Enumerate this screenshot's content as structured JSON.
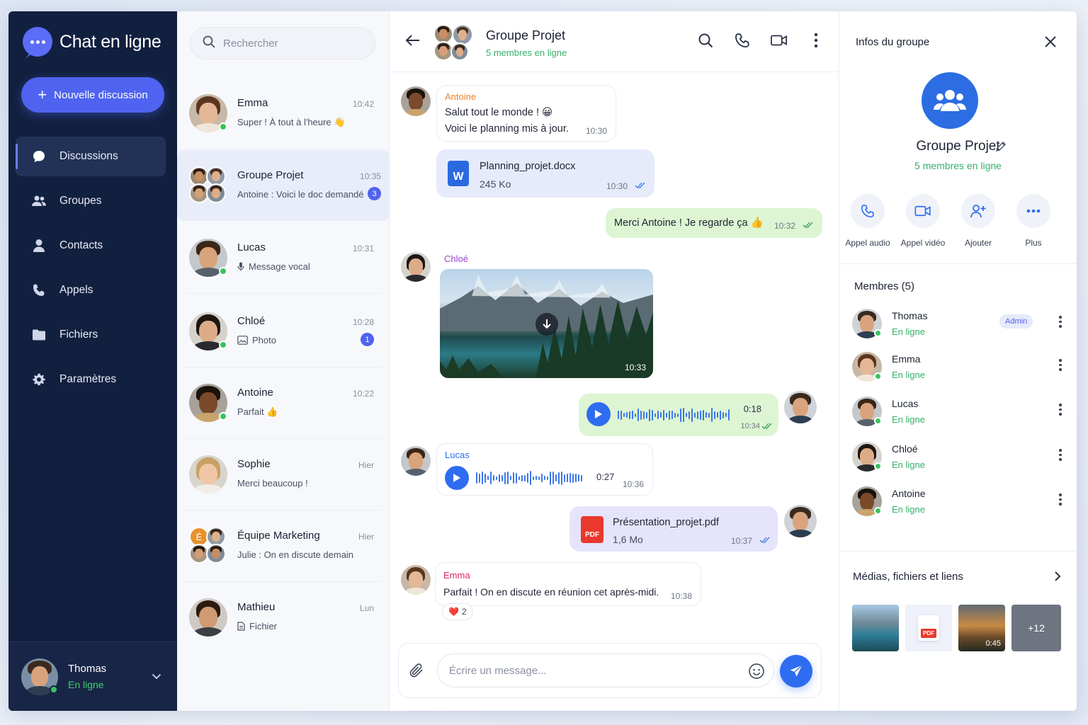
{
  "app": {
    "title": "Chat en ligne",
    "new_chat_label": "Nouvelle discussion"
  },
  "nav": {
    "items": [
      {
        "label": "Discussions",
        "icon": "chat-bubble-icon",
        "active": true
      },
      {
        "label": "Groupes",
        "icon": "users-icon"
      },
      {
        "label": "Contacts",
        "icon": "person-icon"
      },
      {
        "label": "Appels",
        "icon": "phone-icon"
      },
      {
        "label": "Fichiers",
        "icon": "folder-icon"
      },
      {
        "label": "Paramètres",
        "icon": "gear-icon"
      }
    ]
  },
  "current_user": {
    "name": "Thomas",
    "status": "En ligne"
  },
  "search": {
    "placeholder": "Rechercher"
  },
  "conversations": [
    {
      "name": "Emma",
      "time": "10:42",
      "preview": "Super ! À tout à l'heure 👋",
      "online": true
    },
    {
      "name": "Groupe Projet",
      "time": "10:35",
      "preview": "Antoine : Voici le doc demandé",
      "badge": "3",
      "active": true
    },
    {
      "name": "Lucas",
      "time": "10:31",
      "preview": "Message vocal",
      "preview_icon": "microphone-icon",
      "online": true
    },
    {
      "name": "Chloé",
      "time": "10:28",
      "preview": "Photo",
      "preview_icon": "image-icon",
      "badge": "1",
      "online": true
    },
    {
      "name": "Antoine",
      "time": "10:22",
      "preview": "Parfait 👍",
      "online": true
    },
    {
      "name": "Sophie",
      "time": "Hier",
      "preview": "Merci beaucoup !"
    },
    {
      "name": "Équipe Marketing",
      "time": "Hier",
      "preview": "Julie : On en discute demain",
      "group_letter": "É"
    },
    {
      "name": "Mathieu",
      "time": "Lun",
      "preview": "Fichier",
      "preview_icon": "file-icon"
    }
  ],
  "chat": {
    "title": "Groupe Projet",
    "subtitle": "5 membres en ligne",
    "messages": {
      "m1": {
        "sender": "Antoine",
        "line1": "Salut tout le monde ! 😀",
        "line2": "Voici le planning mis à jour.",
        "time": "10:30"
      },
      "m2": {
        "file_name": "Planning_projet.docx",
        "file_size": "245 Ko",
        "file_letter": "W",
        "time": "10:30"
      },
      "m3": {
        "text": "Merci Antoine ! Je regarde ça 👍",
        "time": "10:32"
      },
      "m4": {
        "sender": "Chloé",
        "time": "10:33"
      },
      "m5": {
        "duration": "0:18",
        "time": "10:34"
      },
      "m6": {
        "sender": "Lucas",
        "duration": "0:27",
        "time": "10:36"
      },
      "m7": {
        "file_name": "Présentation_projet.pdf",
        "file_size": "1,6 Mo",
        "file_badge": "PDF",
        "time": "10:37"
      },
      "m8": {
        "sender": "Emma",
        "text": "Parfait ! On en discute en réunion cet après-midi.",
        "time": "10:38",
        "reaction": "❤️",
        "reaction_count": "2"
      }
    },
    "composer_placeholder": "Écrire un message..."
  },
  "info": {
    "title": "Infos du groupe",
    "group_name": "Groupe Projet",
    "group_status": "5 membres en ligne",
    "actions": [
      "Appel audio",
      "Appel vidéo",
      "Ajouter",
      "Plus"
    ],
    "members_title": "Membres (5)",
    "members": [
      {
        "name": "Thomas",
        "status": "En ligne",
        "role": "Admin"
      },
      {
        "name": "Emma",
        "status": "En ligne"
      },
      {
        "name": "Lucas",
        "status": "En ligne"
      },
      {
        "name": "Chloé",
        "status": "En ligne"
      },
      {
        "name": "Antoine",
        "status": "En ligne"
      }
    ],
    "media_title": "Médias, fichiers et liens",
    "media": {
      "pdf_badge": "PDF",
      "video_duration": "0:45",
      "more": "+12"
    }
  },
  "colors": {
    "accent": "#4f63f0",
    "sidebar": "#12203f",
    "online": "#3bc25f",
    "outgoing_bubble": "#ddf5d3"
  }
}
